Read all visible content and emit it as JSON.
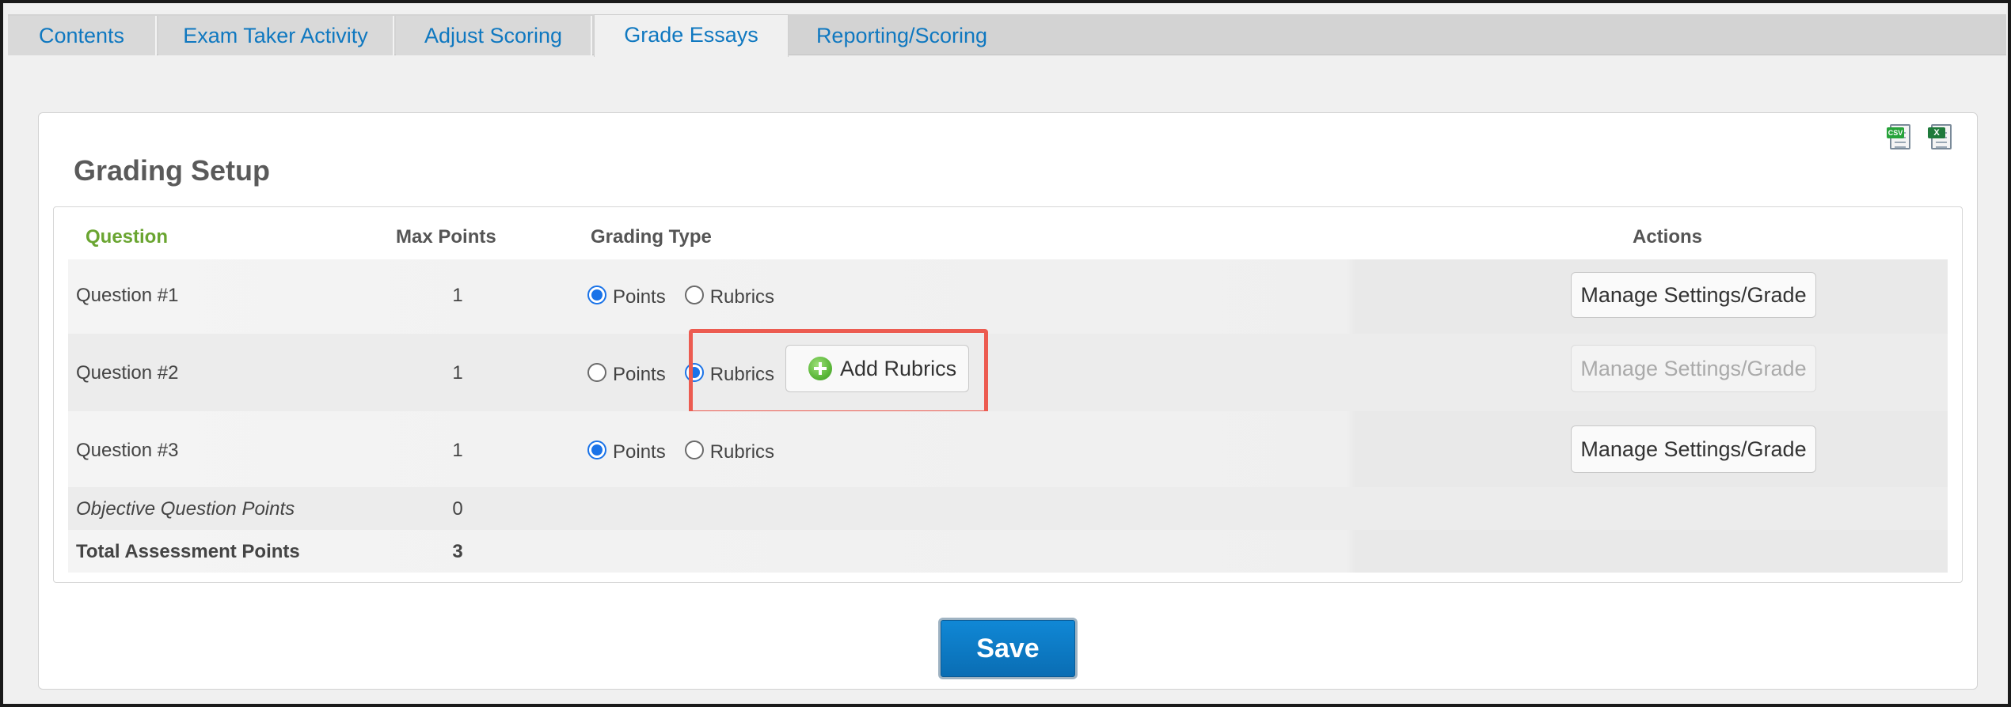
{
  "tabs": [
    {
      "label": "Contents",
      "active": false
    },
    {
      "label": "Exam Taker Activity",
      "active": false
    },
    {
      "label": "Adjust Scoring",
      "active": false
    },
    {
      "label": "Grade Essays",
      "active": true
    },
    {
      "label": "Reporting/Scoring",
      "active": false
    }
  ],
  "export": {
    "csv_icon": "csv-file-icon",
    "excel_icon": "excel-file-icon",
    "csv_tag": "CSV",
    "excel_tag": "X"
  },
  "page_title": "Grading Setup",
  "table": {
    "headers": {
      "question": "Question",
      "max_points": "Max Points",
      "grading_type": "Grading Type",
      "actions": "Actions"
    },
    "rows": [
      {
        "question": "Question #1",
        "max_points": "1",
        "grading_type": "Points",
        "points_label": "Points",
        "rubrics_label": "Rubrics",
        "action": "Manage Settings/Grade",
        "action_enabled": true
      },
      {
        "question": "Question #2",
        "max_points": "1",
        "grading_type": "Rubrics",
        "points_label": "Points",
        "rubrics_label": "Rubrics",
        "add_rubrics_label": "Add Rubrics",
        "action": "Manage Settings/Grade",
        "action_enabled": false
      },
      {
        "question": "Question #3",
        "max_points": "1",
        "grading_type": "Points",
        "points_label": "Points",
        "rubrics_label": "Rubrics",
        "action": "Manage Settings/Grade",
        "action_enabled": true
      }
    ],
    "summary": [
      {
        "label": "Objective Question Points",
        "value": "0"
      },
      {
        "label": "Total Assessment Points",
        "value": "3"
      }
    ]
  },
  "save_label": "Save",
  "colors": {
    "accent": "#0f78c0",
    "save": "#0a7cc6",
    "highlight": "#ec5b50",
    "question_header": "#6aa531"
  }
}
